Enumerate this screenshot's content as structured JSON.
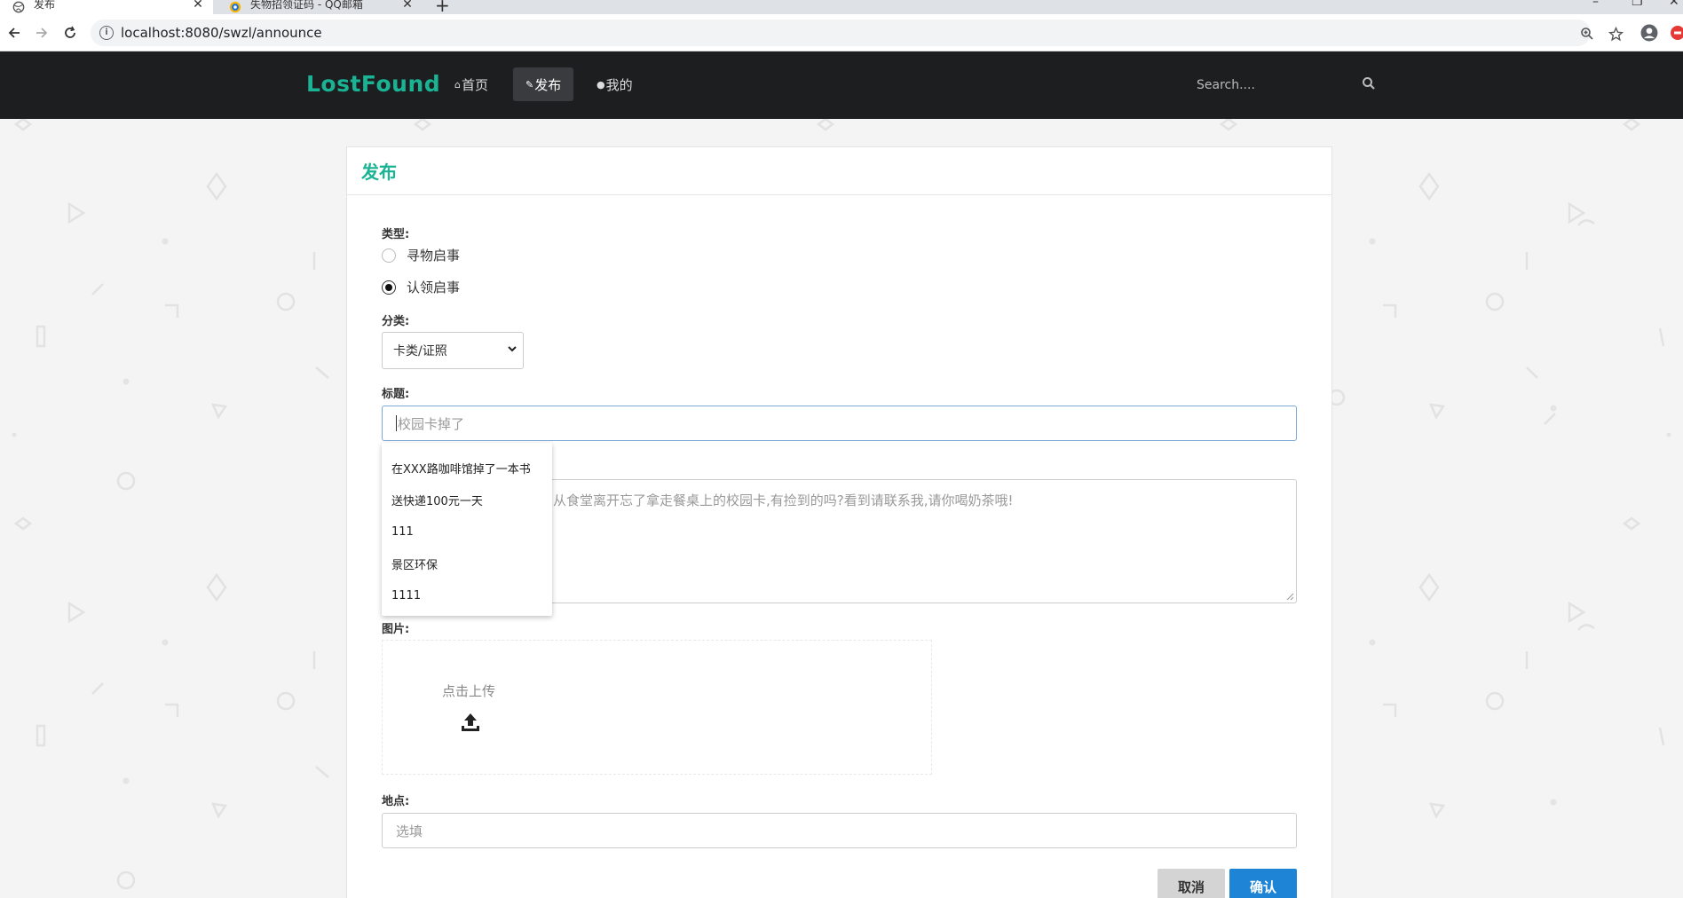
{
  "browser": {
    "tabs": [
      {
        "title": "发布",
        "active": true
      },
      {
        "title": "失物招领证码 - QQ邮箱",
        "active": false
      }
    ],
    "url": "localhost:8080/swzl/announce"
  },
  "nav": {
    "brand": "LostFound",
    "items": [
      {
        "label": "首页",
        "icon": "home-icon"
      },
      {
        "label": "发布",
        "icon": "edit-icon"
      },
      {
        "label": "我的",
        "icon": "user-icon"
      }
    ],
    "search_placeholder": "Search....",
    "accent": "#1ab394"
  },
  "form": {
    "title": "发布",
    "type_label": "类型:",
    "type_options": [
      "寻物启事",
      "认领启事"
    ],
    "type_selected": "认领启事",
    "category_label": "分类:",
    "category_value": "卡类/证照",
    "title_label": "标题:",
    "title_placeholder": "校园卡掉了",
    "description_placeholder": "从食堂离开忘了拿走餐桌上的校园卡,有捡到的吗?看到请联系我,请你喝奶茶哦!",
    "image_label": "图片:",
    "upload_text": "点击上传",
    "location_label": "地点:",
    "location_placeholder": "选填",
    "cancel_label": "取消",
    "confirm_label": "确认",
    "confirm_color": "#1d84d6"
  },
  "autocomplete": [
    "在XXX路咖啡馆掉了一本书",
    "送快递100元一天",
    "111",
    "景区环保",
    "1111"
  ]
}
